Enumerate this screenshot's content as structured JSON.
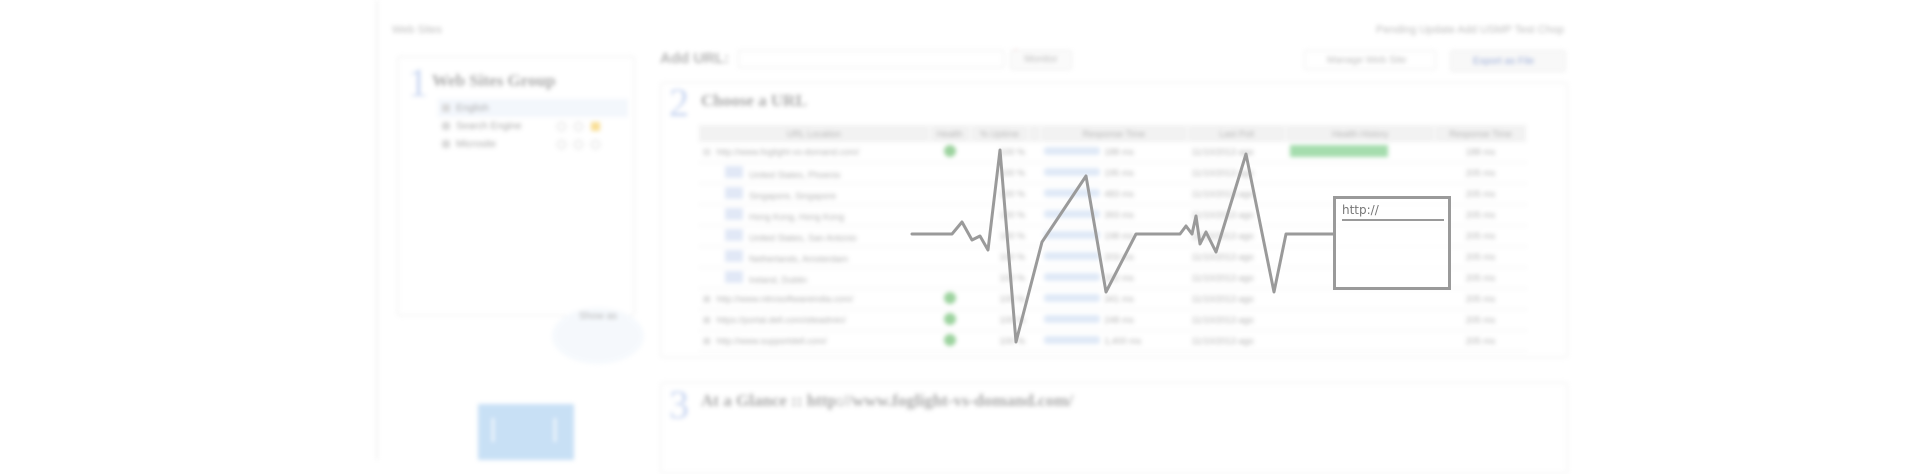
{
  "breadcrumb": "Web Sites",
  "top_links": "Pending Update   Add USMP   Test Chop",
  "step1": {
    "num": "1",
    "title": "Web Sites Group"
  },
  "groups": [
    {
      "label": "English",
      "active": true
    },
    {
      "label": "Search Engine",
      "active": false
    },
    {
      "label": "Microsite",
      "active": false
    }
  ],
  "share_label": "Show as",
  "add_url": {
    "label": "Add URL:",
    "placeholder": "",
    "button": "Monitor"
  },
  "manage_label": "Manage Web Site",
  "export_label": "Export as File",
  "step2": {
    "num": "2",
    "title": "Choose a URL"
  },
  "table": {
    "headers": [
      "URL Location",
      "Health",
      "% Uptime",
      "",
      "Response Time",
      "Last Poll",
      "Health History",
      "Response Time"
    ],
    "rows": [
      {
        "expander": "⊟",
        "url": "http://www.foglight-vs-domand.com/",
        "flag": false,
        "health": true,
        "uptime": "100 %",
        "resp": "188 ms",
        "last": "11/10/2013 ago",
        "history": true,
        "rt": "188 ms"
      },
      {
        "expander": "",
        "url": "United States, Phoenix",
        "flag": true,
        "health": false,
        "uptime": "100 %",
        "resp": "195 ms",
        "last": "11/10/2013 ago",
        "history": false,
        "rt": "205 ms"
      },
      {
        "expander": "",
        "url": "Singapore, Singapore",
        "flag": true,
        "health": false,
        "uptime": "100 %",
        "resp": "483 ms",
        "last": "11/10/2013 ago",
        "history": false,
        "rt": "205 ms"
      },
      {
        "expander": "",
        "url": "Hong Kong, Hong Kong",
        "flag": true,
        "health": false,
        "uptime": "100 %",
        "resp": "393 ms",
        "last": "11/10/2013 ago",
        "history": false,
        "rt": "205 ms"
      },
      {
        "expander": "",
        "url": "United States, San Antonio",
        "flag": true,
        "health": false,
        "uptime": "100 %",
        "resp": "198 ms",
        "last": "11/10/2013 ago",
        "history": false,
        "rt": "205 ms"
      },
      {
        "expander": "",
        "url": "Netherlands, Amsterdam",
        "flag": true,
        "health": false,
        "uptime": "100 %",
        "resp": "203 ms",
        "last": "11/10/2013 ago",
        "history": false,
        "rt": "205 ms"
      },
      {
        "expander": "",
        "url": "Ireland, Dublin",
        "flag": true,
        "health": false,
        "uptime": "100 %",
        "resp": "202 ms",
        "last": "11/10/2013 ago",
        "history": false,
        "rt": "205 ms"
      },
      {
        "expander": "⊞",
        "url": "http://www.nitrosoftwareindia.com/",
        "flag": false,
        "health": true,
        "uptime": "100 %",
        "resp": "341 ms",
        "last": "11/10/2013 ago",
        "history": false,
        "rt": "205 ms"
      },
      {
        "expander": "⊞",
        "url": "https://portal.dell.com/siteadmin/",
        "flag": false,
        "health": true,
        "uptime": "100 %",
        "resp": "248 ms",
        "last": "11/10/2013 ago",
        "history": false,
        "rt": "205 ms"
      },
      {
        "expander": "⊞",
        "url": "http://www.supportdell.com/",
        "flag": false,
        "health": true,
        "uptime": "100 %",
        "resp": "1,400 ms",
        "last": "11/10/2013 ago",
        "history": false,
        "rt": "205 ms"
      }
    ]
  },
  "step3": {
    "num": "3",
    "title": "At a Glance :: http://www.foglight-vs-domand.com/"
  },
  "overlay": {
    "url_text": "http://"
  }
}
